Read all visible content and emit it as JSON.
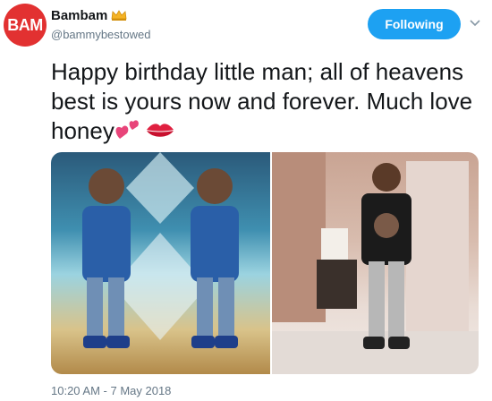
{
  "tweet": {
    "avatar_text": "BAM",
    "display_name": "Bambam",
    "handle": "@bammybestowed",
    "follow_button": "Following",
    "text": "Happy birthday little man; all of heavens best is yours now and forever. Much love honey",
    "timestamp": "10:20 AM - 7 May 2018"
  },
  "icons": {
    "crown": "crown-icon",
    "caret": "chevron-down-icon",
    "hearts": "two-hearts-emoji",
    "kiss": "kiss-mark-emoji"
  },
  "colors": {
    "accent": "#1da1f2",
    "avatar_bg": "#e23131",
    "secondary_text": "#657786"
  }
}
